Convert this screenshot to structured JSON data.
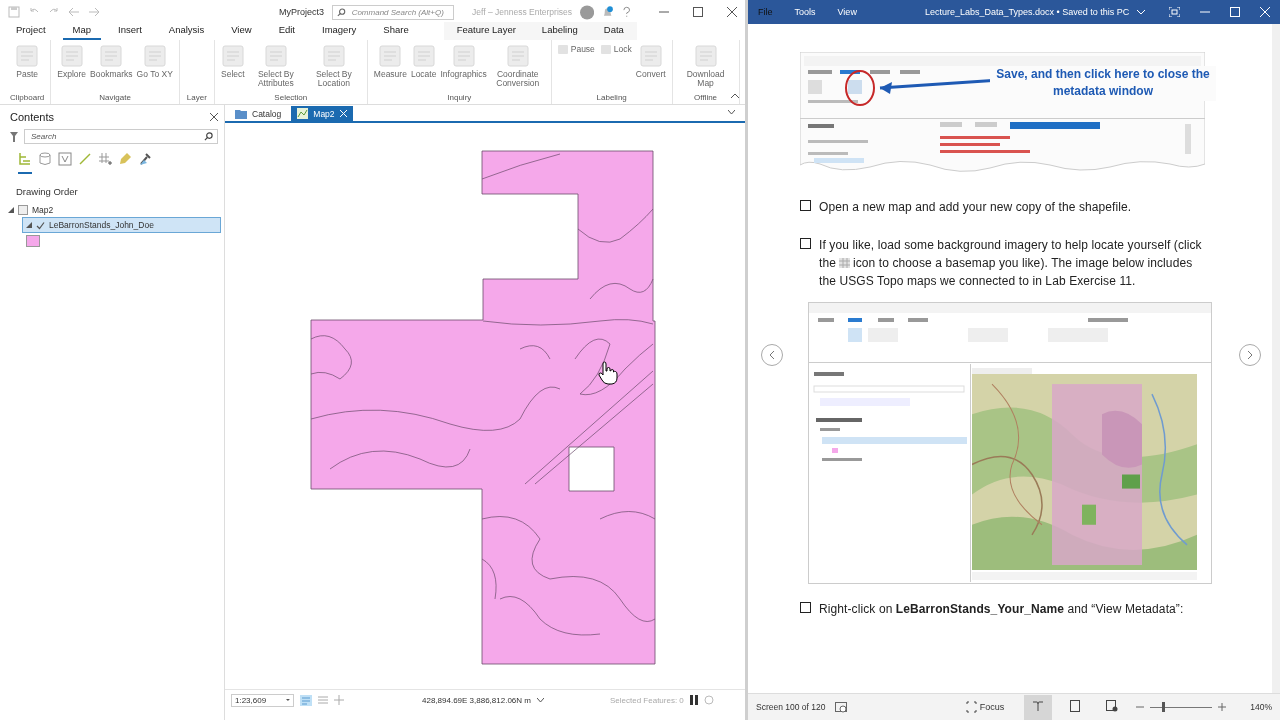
{
  "arcgis": {
    "title_bar": {
      "project": "MyProject3",
      "search_placeholder": "Command Search (Alt+Q)",
      "user": "Jeff – Jenness Enterprises"
    },
    "tabs": [
      {
        "label": "Project",
        "selected": false,
        "kind": "core"
      },
      {
        "label": "Map",
        "selected": true,
        "kind": "core"
      },
      {
        "label": "Insert",
        "selected": false,
        "kind": "core"
      },
      {
        "label": "Analysis",
        "selected": false,
        "kind": "core"
      },
      {
        "label": "View",
        "selected": false,
        "kind": "core"
      },
      {
        "label": "Edit",
        "selected": false,
        "kind": "core"
      },
      {
        "label": "Imagery",
        "selected": false,
        "kind": "core"
      },
      {
        "label": "Share",
        "selected": false,
        "kind": "core"
      },
      {
        "label": "Feature Layer",
        "selected": false,
        "kind": "contextual"
      },
      {
        "label": "Labeling",
        "selected": false,
        "kind": "contextual"
      },
      {
        "label": "Data",
        "selected": false,
        "kind": "contextual"
      }
    ],
    "ribbon_groups": [
      {
        "label": "Clipboard",
        "buttons": [
          "Paste"
        ]
      },
      {
        "label": "Navigate",
        "buttons": [
          "Explore",
          "Bookmarks",
          "Go To XY"
        ]
      },
      {
        "label": "Layer"
      },
      {
        "label": "Selection",
        "buttons": [
          "Select",
          "Select By Attributes",
          "Select By Location"
        ]
      },
      {
        "label": "Inquiry",
        "buttons": [
          "Measure",
          "Locate",
          "Infographics",
          "Coordinate Conversion"
        ]
      },
      {
        "label": "Labeling",
        "small_buttons": [
          "Pause",
          "Lock"
        ],
        "buttons": [
          "Convert"
        ]
      },
      {
        "label": "Offline",
        "buttons": [
          "Download Map"
        ]
      }
    ],
    "contents": {
      "title": "Contents",
      "search_placeholder": "Search",
      "view_buttons": [
        {
          "selected": true
        },
        {
          "selected": false
        },
        {
          "selected": false
        },
        {
          "selected": false
        },
        {
          "selected": false
        },
        {
          "selected": false
        },
        {
          "selected": false
        }
      ],
      "heading": "Drawing Order",
      "tree": [
        {
          "label": "Map2",
          "expanded": true,
          "children": [
            {
              "label": "LeBarronStands_John_Doe",
              "selected": true,
              "checked": true,
              "expanded": true,
              "color": "#f5a8ea"
            }
          ]
        }
      ]
    },
    "view_tabs": [
      {
        "label": "Catalog",
        "selected": false
      },
      {
        "label": "Map2",
        "selected": true
      }
    ],
    "status_bar": {
      "scale": "1:23,609",
      "coordinates": "428,894.69E 3,886,812.06N m",
      "selected_features": "Selected Features: 0"
    }
  },
  "word": {
    "menu": [
      "File",
      "Tools",
      "View"
    ],
    "title": "Lecture_Labs_Data_Types.docx • Saved to this PC",
    "blocks": [
      {
        "kind": "metadata_screenshot",
        "callout": "Save, and then click here to close the metadata window"
      },
      {
        "kind": "check",
        "checked": false,
        "text": "Open a new map and add your new copy of the shapefile."
      },
      {
        "kind": "check",
        "checked": false,
        "text": "If you like, load some background imagery to help locate yourself (click the",
        "text_after": "icon to choose a basemap you like). The image below includes the USGS Topo maps we connected to in Lab Exercise 11."
      },
      {
        "kind": "topo_screenshot"
      },
      {
        "kind": "check",
        "checked": false,
        "text": "Right-click on **LeBarronStands_Your_Name** and “View Metadata”:"
      }
    ],
    "status_bar": {
      "position": "Screen 100 of 120",
      "focus": "Focus",
      "zoom": "140%",
      "level": 0.21
    }
  }
}
